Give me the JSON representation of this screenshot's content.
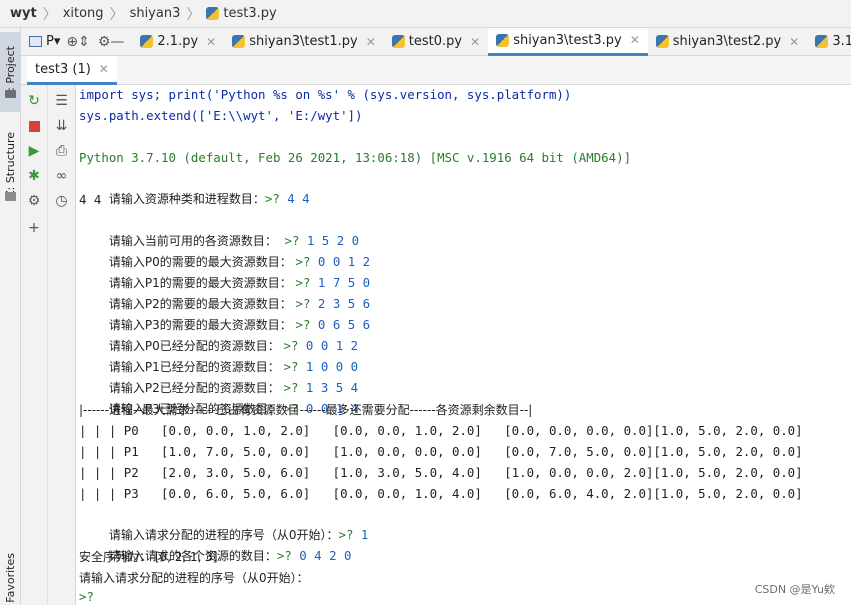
{
  "breadcrumb": [
    "wyt",
    "xitong",
    "shiyan3",
    "test3.py"
  ],
  "left_tabs": {
    "project": "1: Project",
    "structure": "Z: Structure",
    "favorites": "Favorites"
  },
  "toolbar": {
    "project_label": "P▾"
  },
  "editor_tabs": [
    {
      "label": "2.1.py",
      "active": false
    },
    {
      "label": "shiyan3\\test1.py",
      "active": false
    },
    {
      "label": "test0.py",
      "active": false
    },
    {
      "label": "shiyan3\\test3.py",
      "active": true
    },
    {
      "label": "shiyan3\\test2.py",
      "active": false
    },
    {
      "label": "3.1.py",
      "active": false
    }
  ],
  "run_tab": "test3 (1)",
  "console": {
    "cmd1": "import sys; print('Python %s on %s' % (sys.version, sys.platform))",
    "cmd2": "sys.path.extend(['E:\\\\wyt', 'E:/wyt'])",
    "sysinfo": "Python 3.7.10 (default, Feb 26 2021, 13:06:18) [MSC v.1916 64 bit (AMD64)]",
    "l_types_prompt": "请输入资源种类和进程数目：",
    "l_types_input": "4 4",
    "l_echo": "4 4",
    "l_avail_prompt": "请输入当前可用的各资源数目：  ",
    "l_avail_input": "1 5 2 0",
    "max_prompts": [
      {
        "prompt": "请输入P0的需要的最大资源数目： ",
        "input": "0 0 1 2"
      },
      {
        "prompt": "请输入P1的需要的最大资源数目： ",
        "input": "1 7 5 0"
      },
      {
        "prompt": "请输入P2的需要的最大资源数目： ",
        "input": "2 3 5 6"
      },
      {
        "prompt": "请输入P3的需要的最大资源数目： ",
        "input": "0 6 5 6"
      }
    ],
    "alloc_prompts": [
      {
        "prompt": "请输入P0已经分配的资源数目： ",
        "input": "0 0 1 2"
      },
      {
        "prompt": "请输入P1已经分配的资源数目： ",
        "input": "1 0 0 0"
      },
      {
        "prompt": "请输入P2已经分配的资源数目： ",
        "input": "1 3 5 4"
      },
      {
        "prompt": "请输入P3已经分配的资源数目： ",
        "input": "0 0 1 4"
      }
    ],
    "table_header": "|------进程--最大需求------已占有资源数目------最多还需要分配------各资源剩余数目--|",
    "table_rows": [
      "| | | P0   [0.0, 0.0, 1.0, 2.0]   [0.0, 0.0, 1.0, 2.0]   [0.0, 0.0, 0.0, 0.0][1.0, 5.0, 2.0, 0.0]",
      "| | | P1   [1.0, 7.0, 5.0, 0.0]   [1.0, 0.0, 0.0, 0.0]   [0.0, 7.0, 5.0, 0.0][1.0, 5.0, 2.0, 0.0]",
      "| | | P2   [2.0, 3.0, 5.0, 6.0]   [1.0, 3.0, 5.0, 4.0]   [1.0, 0.0, 0.0, 2.0][1.0, 5.0, 2.0, 0.0]",
      "| | | P3   [0.0, 6.0, 5.0, 6.0]   [0.0, 0.0, 1.0, 4.0]   [0.0, 6.0, 4.0, 2.0][1.0, 5.0, 2.0, 0.0]"
    ],
    "req_proc_prompt": "请输入请求分配的进程的序号（从0开始）：",
    "req_proc_input": "1",
    "req_res_prompt": "请输入请求的各个资源的数目：",
    "req_res_input": "0 4 2 0",
    "safe_seq": "安全序列为： [0, 2, 1, 3]",
    "req_proc_prompt2": "请输入请求分配的进程的序号（从0开始）：",
    "final_prompt": ">?",
    "chevron": ">?"
  },
  "watermark": "CSDN @是Yu欸"
}
